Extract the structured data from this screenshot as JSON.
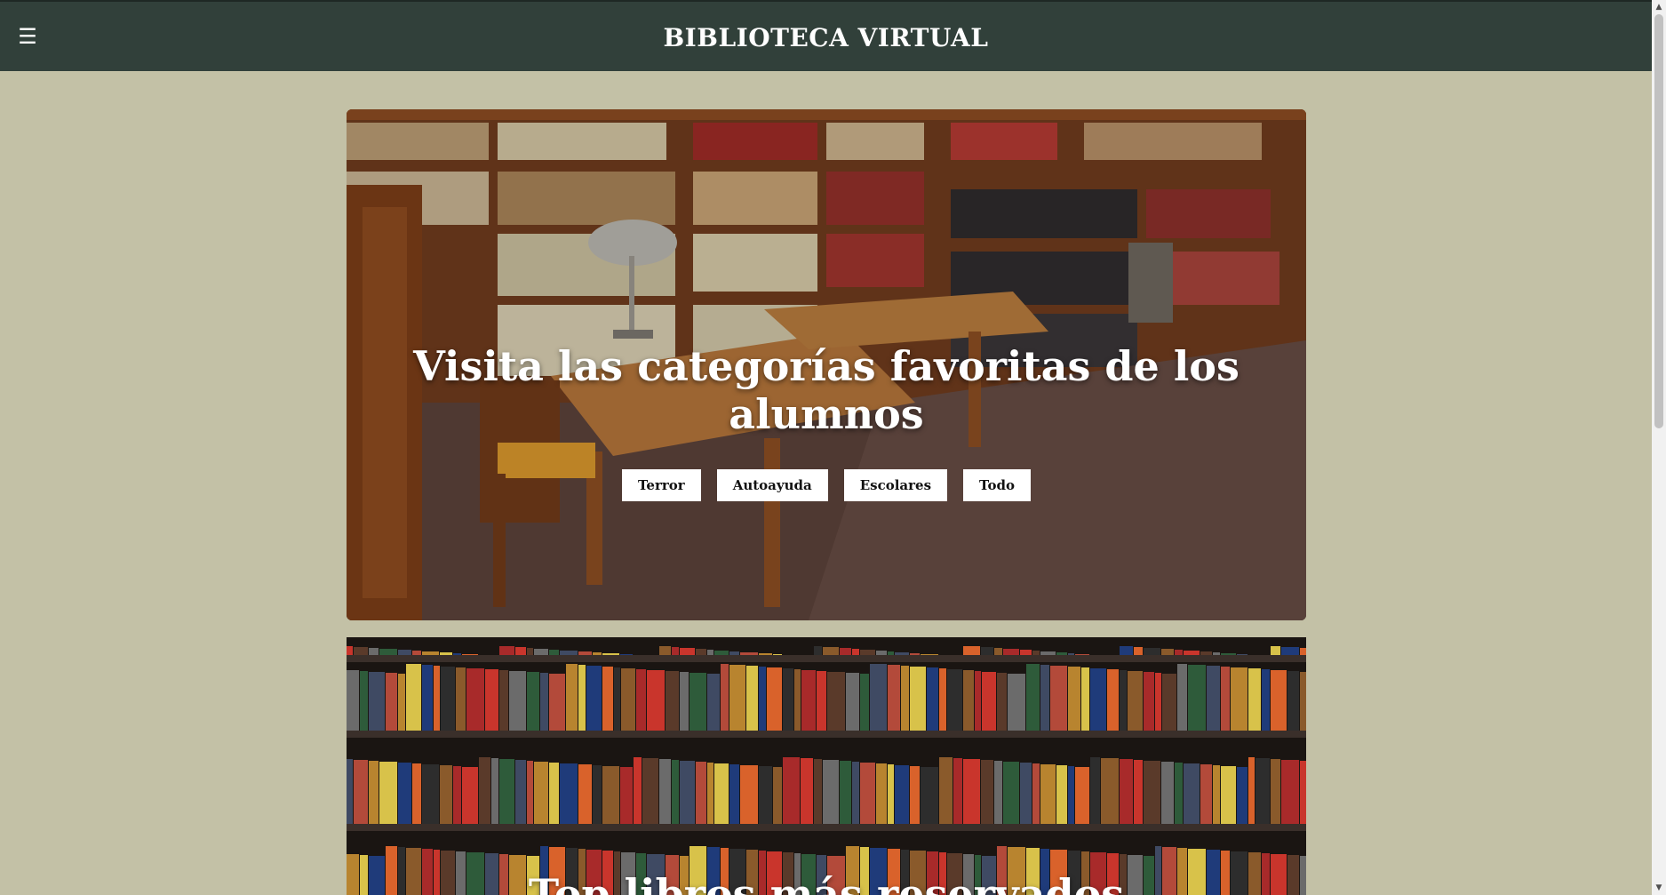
{
  "header": {
    "menu_icon": "☰",
    "title": "BIBLIOTECA VIRTUAL"
  },
  "hero": {
    "title": "Visita las categorías favoritas de los alumnos",
    "categories": [
      "Terror",
      "Autoayuda",
      "Escolares",
      "Todo"
    ]
  },
  "second_section": {
    "title": "Top libros más reservados"
  },
  "scrollbar": {
    "up_icon": "▲",
    "down_icon": "▼"
  },
  "colors": {
    "header_bg": "#31403a",
    "page_bg": "#c3c1a6",
    "button_bg": "#ffffff"
  }
}
